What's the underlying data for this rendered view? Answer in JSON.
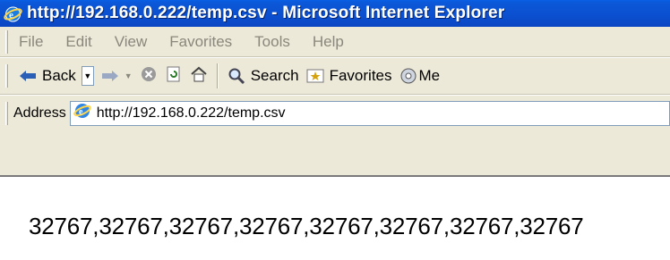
{
  "window": {
    "title": "http://192.168.0.222/temp.csv - Microsoft Internet Explorer"
  },
  "menu": [
    "File",
    "Edit",
    "View",
    "Favorites",
    "Tools",
    "Help"
  ],
  "toolbar": {
    "back_label": "Back",
    "search_label": "Search",
    "favorites_label": "Favorites",
    "media_label": "Me"
  },
  "address": {
    "label": "Address",
    "url": "http://192.168.0.222/temp.csv"
  },
  "content": {
    "text": "32767,32767,32767,32767,32767,32767,32767,32767"
  }
}
